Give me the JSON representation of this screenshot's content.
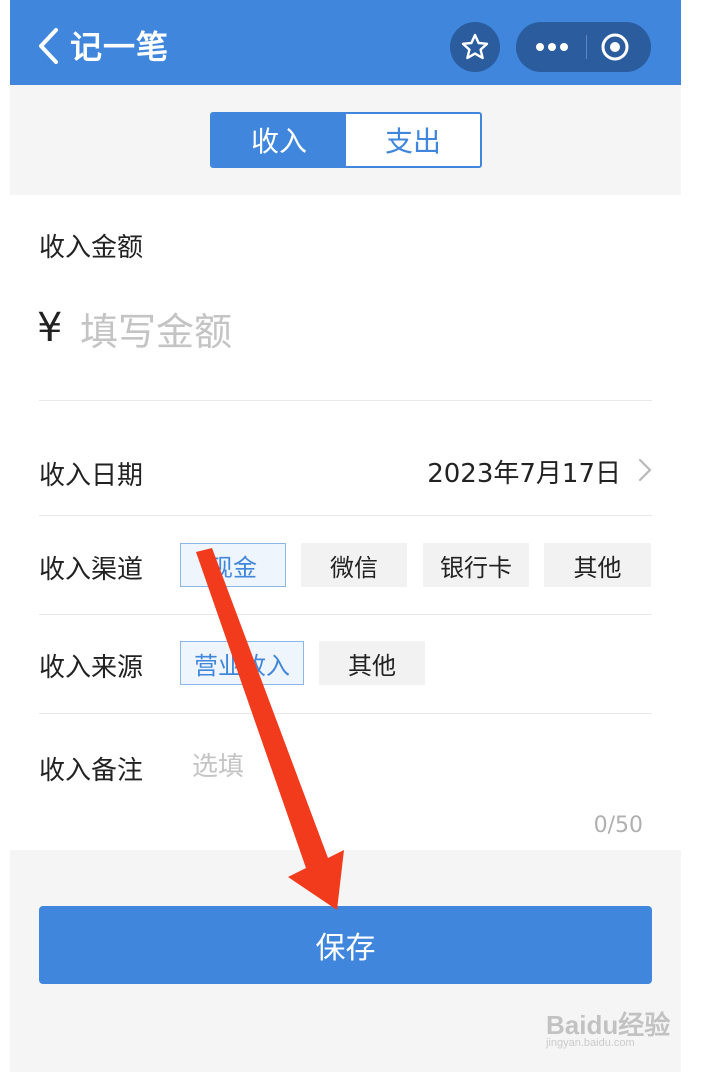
{
  "header": {
    "title": "记一笔",
    "back_icon": "chevron-left-icon",
    "star_icon": "star-icon",
    "more_icon": "more-dots-icon",
    "close_icon": "target-circle-icon",
    "bg_color": "#3f86dc"
  },
  "segment": {
    "tabs": [
      {
        "label": "收入",
        "active": true
      },
      {
        "label": "支出",
        "active": false
      }
    ]
  },
  "form": {
    "amount": {
      "label": "收入金额",
      "currency": "¥",
      "placeholder": "填写金额"
    },
    "date": {
      "label": "收入日期",
      "value": "2023年7月17日"
    },
    "channel": {
      "label": "收入渠道",
      "options": [
        "现金",
        "微信",
        "银行卡",
        "其他"
      ],
      "selected": "现金"
    },
    "source": {
      "label": "收入来源",
      "options": [
        "营业收入",
        "其他"
      ],
      "selected": "营业收入"
    },
    "note": {
      "label": "收入备注",
      "placeholder": "选填",
      "counter": "0/50"
    }
  },
  "save_label": "保存",
  "accent_color": "#3f86dc",
  "annotation_arrow_color": "#f23a1c",
  "watermark": {
    "main": "Baidu经验",
    "sub": "jingyan.baidu.com"
  }
}
